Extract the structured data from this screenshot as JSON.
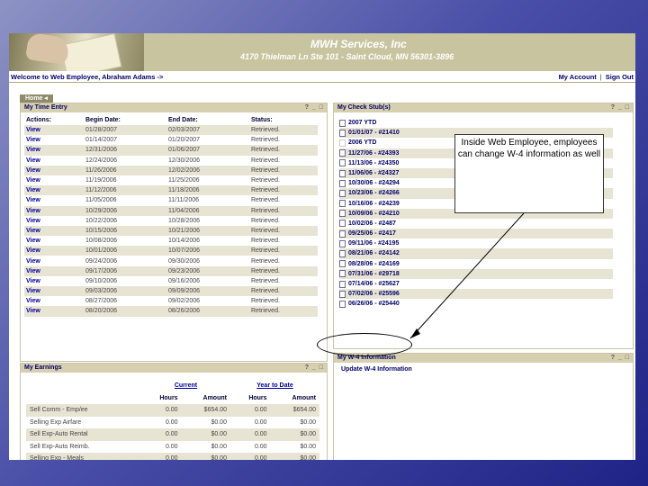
{
  "header": {
    "company": "MWH Services, Inc",
    "address": "4170 Thielman Ln Ste 101 - Saint Cloud, MN 56301-3896"
  },
  "topbar": {
    "welcome": "Welcome to Web Employee, Abraham Adams ->",
    "my_account": "My Account",
    "separator": "|",
    "sign_out": "Sign Out"
  },
  "tabs": [
    {
      "label": "Home"
    }
  ],
  "time_entry": {
    "title": "My Time Entry",
    "icons": "? _ □",
    "columns": [
      "Actions:",
      "Begin Date:",
      "End Date:",
      "Status:"
    ],
    "rows": [
      {
        "action": "View",
        "begin": "01/28/2007",
        "end": "02/03/2007",
        "status": "Retrieved."
      },
      {
        "action": "View",
        "begin": "01/14/2007",
        "end": "01/20/2007",
        "status": "Retrieved."
      },
      {
        "action": "View",
        "begin": "12/31/2006",
        "end": "01/06/2007",
        "status": "Retrieved."
      },
      {
        "action": "View",
        "begin": "12/24/2006",
        "end": "12/30/2006",
        "status": "Retrieved."
      },
      {
        "action": "View",
        "begin": "11/26/2006",
        "end": "12/02/2006",
        "status": "Retrieved."
      },
      {
        "action": "View",
        "begin": "11/19/2006",
        "end": "11/25/2006",
        "status": "Retrieved."
      },
      {
        "action": "View",
        "begin": "11/12/2006",
        "end": "11/18/2006",
        "status": "Retrieved."
      },
      {
        "action": "View",
        "begin": "11/05/2006",
        "end": "11/11/2006",
        "status": "Retrieved."
      },
      {
        "action": "View",
        "begin": "10/29/2006",
        "end": "11/04/2006",
        "status": "Retrieved."
      },
      {
        "action": "View",
        "begin": "10/22/2006",
        "end": "10/28/2006",
        "status": "Retrieved."
      },
      {
        "action": "View",
        "begin": "10/15/2006",
        "end": "10/21/2006",
        "status": "Retrieved."
      },
      {
        "action": "View",
        "begin": "10/08/2006",
        "end": "10/14/2006",
        "status": "Retrieved."
      },
      {
        "action": "View",
        "begin": "10/01/2006",
        "end": "10/07/2006",
        "status": "Retrieved."
      },
      {
        "action": "View",
        "begin": "09/24/2006",
        "end": "09/30/2006",
        "status": "Retrieved."
      },
      {
        "action": "View",
        "begin": "09/17/2006",
        "end": "09/23/2006",
        "status": "Retrieved."
      },
      {
        "action": "View",
        "begin": "09/10/2006",
        "end": "09/16/2006",
        "status": "Retrieved."
      },
      {
        "action": "View",
        "begin": "09/03/2006",
        "end": "09/09/2006",
        "status": "Retrieved."
      },
      {
        "action": "View",
        "begin": "08/27/2006",
        "end": "09/02/2006",
        "status": "Retrieved."
      },
      {
        "action": "View",
        "begin": "08/20/2006",
        "end": "08/26/2006",
        "status": "Retrieved."
      }
    ]
  },
  "check_stubs": {
    "title": "My Check Stub(s)",
    "icons": "? _ □",
    "items": [
      {
        "label": "2007 YTD",
        "doc": true
      },
      {
        "label": "01/01/07 - #21410",
        "doc": true
      },
      {
        "label": "2006 YTD",
        "doc": false
      },
      {
        "label": "11/27/06 - #24393",
        "doc": true
      },
      {
        "label": "11/13/06 - #24350",
        "doc": true
      },
      {
        "label": "11/06/06 - #24327",
        "doc": true
      },
      {
        "label": "10/30/06 - #24294",
        "doc": true
      },
      {
        "label": "10/23/06 - #24266",
        "doc": true
      },
      {
        "label": "10/16/06 - #24239",
        "doc": true
      },
      {
        "label": "10/09/06 - #24210",
        "doc": true
      },
      {
        "label": "10/02/06 - #2487",
        "doc": true
      },
      {
        "label": "09/25/06 - #2417",
        "doc": true
      },
      {
        "label": "09/11/06 - #24195",
        "doc": true
      },
      {
        "label": "08/21/06 - #24142",
        "doc": true
      },
      {
        "label": "08/28/06 - #24169",
        "doc": true
      },
      {
        "label": "07/31/06 - #29718",
        "doc": true
      },
      {
        "label": "07/14/06 - #25627",
        "doc": true
      },
      {
        "label": "07/02/06 - #25596",
        "doc": true
      },
      {
        "label": "06/26/06 - #25440",
        "doc": true
      }
    ]
  },
  "w4": {
    "title": "My W-4 Information",
    "icons": "? _ □",
    "link": "Update W-4 Information"
  },
  "earnings": {
    "title": "My Earnings",
    "icons": "? _ □",
    "group_current": "Current",
    "group_ytd": "Year to Date",
    "col_hours": "Hours",
    "col_amount": "Amount",
    "rows": [
      {
        "name": "Sell Comm - Emp/ee",
        "cur_hours": "0.00",
        "cur_amount": "$654.00",
        "ytd_hours": "0.00",
        "ytd_amount": "$654.00"
      },
      {
        "name": "Selling Exp Airfare",
        "cur_hours": "0.00",
        "cur_amount": "$0.00",
        "ytd_hours": "0.00",
        "ytd_amount": "$0.00"
      },
      {
        "name": "Sell Exp-Auto Rental",
        "cur_hours": "0.00",
        "cur_amount": "$0.00",
        "ytd_hours": "0.00",
        "ytd_amount": "$0.00"
      },
      {
        "name": "Sell Exp-Auto Reimb.",
        "cur_hours": "0.00",
        "cur_amount": "$0.00",
        "ytd_hours": "0.00",
        "ytd_amount": "$0.00"
      },
      {
        "name": "Selling Exp - Meals",
        "cur_hours": "0.00",
        "cur_amount": "$0.00",
        "ytd_hours": "0.00",
        "ytd_amount": "$0.00"
      }
    ]
  },
  "callout": {
    "text": "Inside Web Employee, employees can change W-4 information as well"
  }
}
